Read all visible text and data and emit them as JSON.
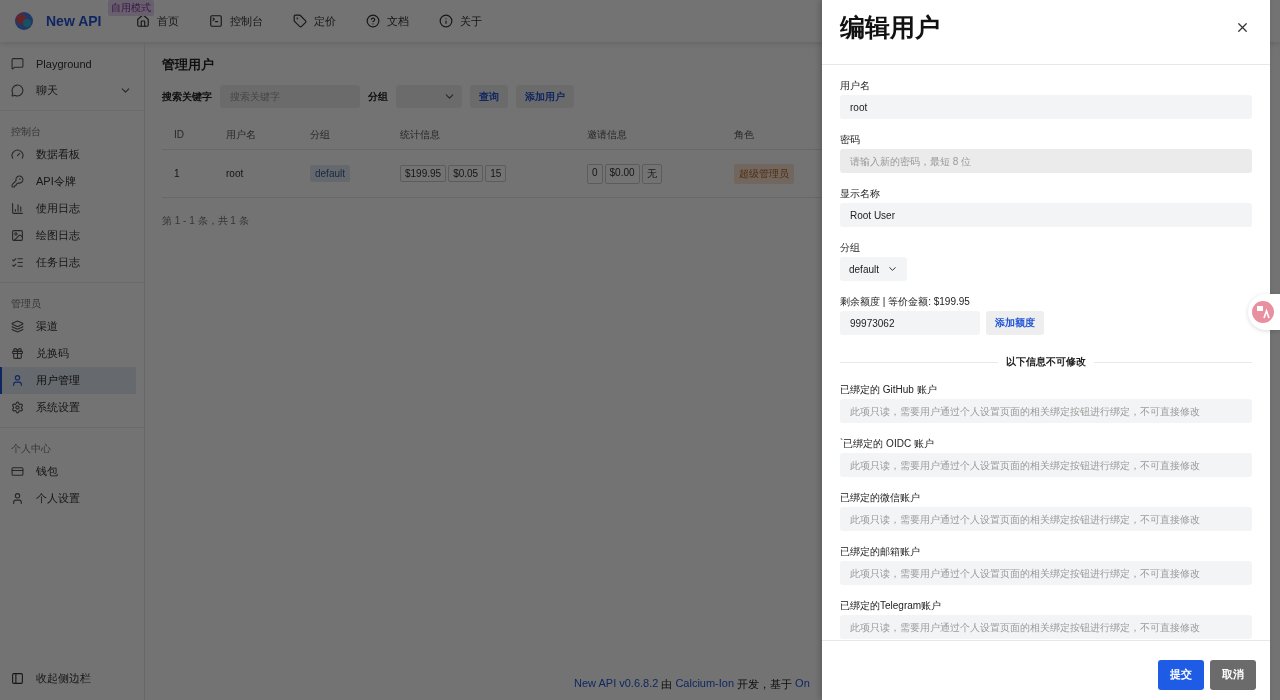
{
  "header": {
    "brand": "New API",
    "badge": "自用模式",
    "nav": [
      {
        "label": "首页"
      },
      {
        "label": "控制台"
      },
      {
        "label": "定价"
      },
      {
        "label": "文档"
      },
      {
        "label": "关于"
      }
    ]
  },
  "sidebar": {
    "sections": [
      {
        "items": [
          {
            "label": "Playground",
            "selected": false
          },
          {
            "label": "聊天",
            "selected": false,
            "expanded": false
          }
        ]
      },
      {
        "title": "控制台",
        "items": [
          {
            "label": "数据看板",
            "selected": false
          },
          {
            "label": "API令牌",
            "selected": false
          },
          {
            "label": "使用日志",
            "selected": false
          },
          {
            "label": "绘图日志",
            "selected": false
          },
          {
            "label": "任务日志",
            "selected": false
          }
        ]
      },
      {
        "title": "管理员",
        "items": [
          {
            "label": "渠道",
            "selected": false
          },
          {
            "label": "兑换码",
            "selected": false
          },
          {
            "label": "用户管理",
            "selected": true
          },
          {
            "label": "系统设置",
            "selected": false
          }
        ]
      },
      {
        "title": "个人中心",
        "items": [
          {
            "label": "钱包",
            "selected": false
          },
          {
            "label": "个人设置",
            "selected": false
          }
        ]
      }
    ],
    "collapse": "收起侧边栏"
  },
  "content": {
    "title": "管理用户",
    "search_label": "搜索关键字",
    "search": {
      "placeholder": "搜索关键字"
    },
    "group_label": "分组",
    "buttons": [
      "查询",
      "添加用户"
    ],
    "table": {
      "columns": [
        "ID",
        "用户名",
        "分组",
        "统计信息",
        "邀请信息",
        "角色"
      ],
      "rows": [
        {
          "id": "1",
          "username": "root",
          "group": "default",
          "stats": [
            "$199.95",
            "$0.05",
            "15"
          ],
          "invite": [
            "0",
            "$0.00",
            "无"
          ],
          "role": "超级管理员"
        }
      ]
    },
    "pagination": "第 1 - 1 条，共 1 条",
    "footer": [
      {
        "text": "New API v0.6.8.2",
        "link": true
      },
      {
        "text": "由",
        "link": false
      },
      {
        "text": "Calcium-Ion",
        "link": true
      },
      {
        "text": "开发，基于",
        "link": false
      },
      {
        "text": "On",
        "link": true
      }
    ]
  },
  "drawer": {
    "title": "编辑用户",
    "fields": [
      {
        "kind": "text",
        "label": "用户名",
        "value": "root"
      },
      {
        "kind": "password",
        "label": "密码",
        "placeholder": "请输入新的密码，最短 8 位"
      },
      {
        "kind": "text",
        "label": "显示名称",
        "value": "Root User"
      },
      {
        "kind": "select",
        "label": "分组",
        "value": "default"
      },
      {
        "kind": "quota",
        "label": "剩余额度 | 等价金额: $199.95",
        "value": "99973062",
        "button": "添加额度"
      }
    ],
    "divider": "以下信息不可修改",
    "readonly": [
      {
        "label": "已绑定的 GitHub 账户",
        "placeholder": "此项只读，需要用户通过个人设置页面的相关绑定按钮进行绑定，不可直接修改"
      },
      {
        "label": "`已绑定的 OIDC 账户",
        "placeholder": "此项只读，需要用户通过个人设置页面的相关绑定按钮进行绑定，不可直接修改"
      },
      {
        "label": "已绑定的微信账户",
        "placeholder": "此项只读，需要用户通过个人设置页面的相关绑定按钮进行绑定，不可直接修改"
      },
      {
        "label": "已绑定的邮箱账户",
        "placeholder": "此项只读，需要用户通过个人设置页面的相关绑定按钮进行绑定，不可直接修改"
      },
      {
        "label": "已绑定的Telegram账户",
        "placeholder": "此项只读，需要用户通过个人设置页面的相关绑定按钮进行绑定，不可直接修改"
      }
    ],
    "submit": "提交",
    "cancel": "取消"
  }
}
